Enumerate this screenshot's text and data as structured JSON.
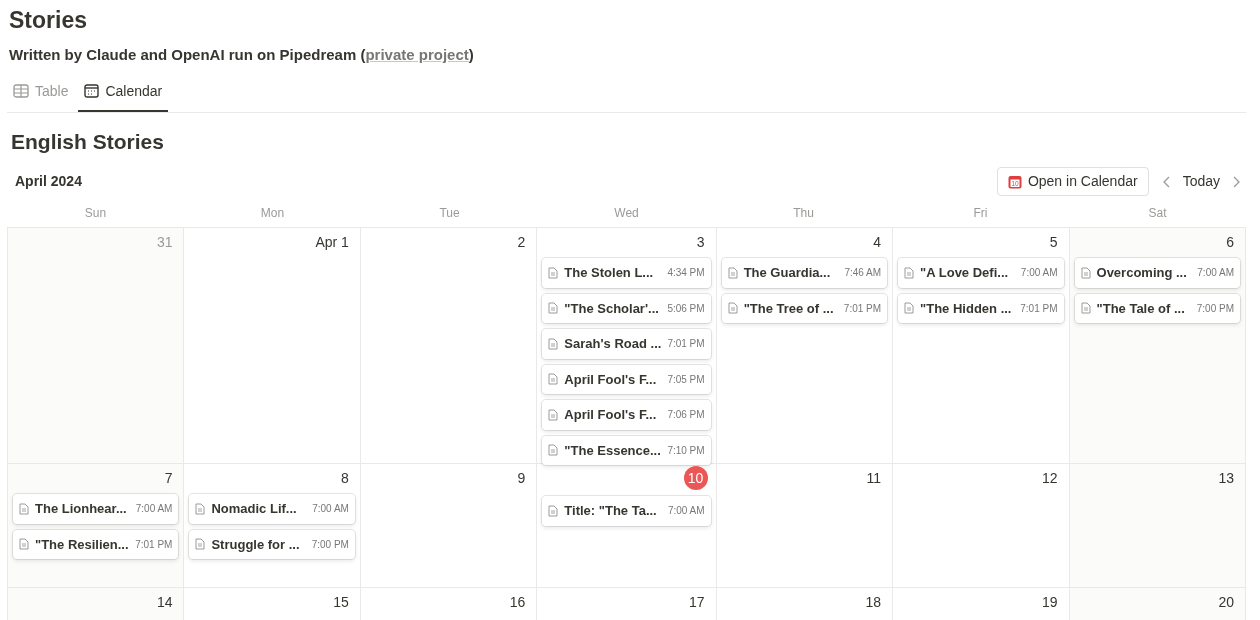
{
  "page": {
    "title": "Stories",
    "subtitle_prefix": "Written by Claude and OpenAI run on Pipedream (",
    "subtitle_link": "private project",
    "subtitle_suffix": ")"
  },
  "tabs": [
    {
      "label": "Table",
      "kind": "table",
      "selected": false
    },
    {
      "label": "Calendar",
      "kind": "calendar",
      "selected": true
    }
  ],
  "calendar": {
    "title": "English Stories",
    "month": "April 2024",
    "open_button": "Open in Calendar",
    "open_icon_day": "10",
    "today_button": "Today",
    "weekdays": [
      "Sun",
      "Mon",
      "Tue",
      "Wed",
      "Thu",
      "Fri",
      "Sat"
    ],
    "weeks": [
      [
        {
          "label": "31",
          "outside_month": true,
          "today": false
        },
        {
          "label": "Apr 1",
          "outside_month": false,
          "today": false
        },
        {
          "label": "2",
          "outside_month": false,
          "today": false
        },
        {
          "label": "3",
          "outside_month": false,
          "today": false,
          "events": [
            {
              "title": "The Stolen L...",
              "time": "4:34 PM"
            },
            {
              "title": "\"The Scholar'...",
              "time": "5:06 PM"
            },
            {
              "title": "Sarah's Road ...",
              "time": "7:01 PM"
            },
            {
              "title": "April Fool's F...",
              "time": "7:05 PM"
            },
            {
              "title": "April Fool's F...",
              "time": "7:06 PM"
            },
            {
              "title": "\"The Essence...",
              "time": "7:10 PM"
            }
          ]
        },
        {
          "label": "4",
          "outside_month": false,
          "today": false,
          "events": [
            {
              "title": "The Guardia...",
              "time": "7:46 AM"
            },
            {
              "title": "\"The Tree of ...",
              "time": "7:01 PM"
            }
          ]
        },
        {
          "label": "5",
          "outside_month": false,
          "today": false,
          "events": [
            {
              "title": "\"A Love Defi...",
              "time": "7:00 AM"
            },
            {
              "title": "\"The Hidden ...",
              "time": "7:01 PM"
            }
          ]
        },
        {
          "label": "6",
          "outside_month": false,
          "today": false,
          "events": [
            {
              "title": "Overcoming ...",
              "time": "7:00 AM"
            },
            {
              "title": "\"The Tale of ...",
              "time": "7:00 PM"
            }
          ]
        }
      ],
      [
        {
          "label": "7",
          "outside_month": false,
          "today": false,
          "events": [
            {
              "title": "The Lionhear...",
              "time": "7:00 AM"
            },
            {
              "title": "\"The Resilien...",
              "time": "7:01 PM"
            }
          ]
        },
        {
          "label": "8",
          "outside_month": false,
          "today": false,
          "events": [
            {
              "title": "Nomadic Lif...",
              "time": "7:00 AM"
            },
            {
              "title": "Struggle for ...",
              "time": "7:00 PM"
            }
          ]
        },
        {
          "label": "9",
          "outside_month": false,
          "today": false
        },
        {
          "label": "10",
          "outside_month": false,
          "today": true,
          "events": [
            {
              "title": "Title: \"The Ta...",
              "time": "7:00 AM"
            }
          ]
        },
        {
          "label": "11",
          "outside_month": false,
          "today": false
        },
        {
          "label": "12",
          "outside_month": false,
          "today": false
        },
        {
          "label": "13",
          "outside_month": false,
          "today": false
        }
      ],
      [
        {
          "label": "14",
          "outside_month": false,
          "today": false
        },
        {
          "label": "15",
          "outside_month": false,
          "today": false
        },
        {
          "label": "16",
          "outside_month": false,
          "today": false
        },
        {
          "label": "17",
          "outside_month": false,
          "today": false
        },
        {
          "label": "18",
          "outside_month": false,
          "today": false
        },
        {
          "label": "19",
          "outside_month": false,
          "today": false
        },
        {
          "label": "20",
          "outside_month": false,
          "today": false
        }
      ]
    ]
  }
}
